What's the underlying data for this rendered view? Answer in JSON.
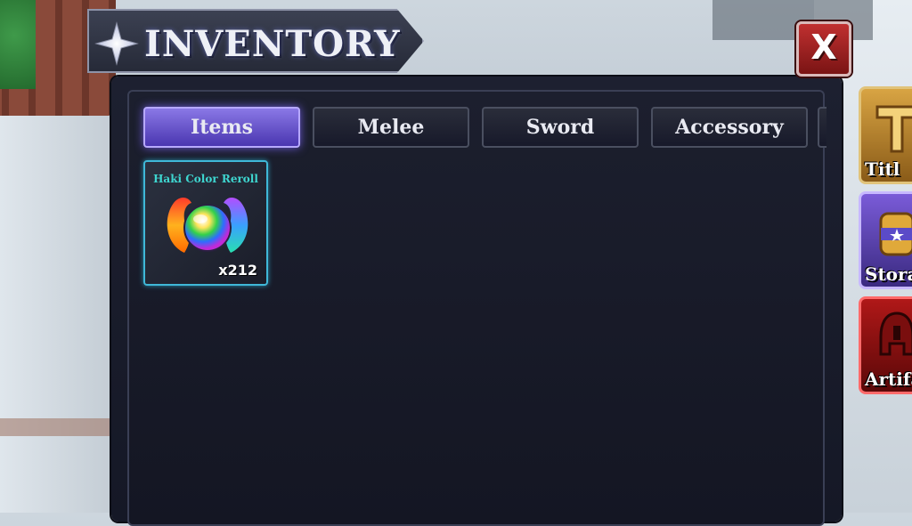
{
  "header": {
    "title": "INVENTORY"
  },
  "close_button": {
    "label": "X"
  },
  "tabs": [
    {
      "label": "Items",
      "active": true
    },
    {
      "label": "Melee",
      "active": false
    },
    {
      "label": "Sword",
      "active": false
    },
    {
      "label": "Accessory",
      "active": false
    }
  ],
  "items": [
    {
      "name": "Haki Color Reroll",
      "quantity": "x212"
    }
  ],
  "side_menu": [
    {
      "label": "Titl",
      "icon": "title-icon",
      "border": "#e1c37a"
    },
    {
      "label": "Stora",
      "icon": "storage-icon",
      "border": "#c7b8ff"
    },
    {
      "label": "Artifa",
      "icon": "artifact-icon",
      "border": "#ff6a6a"
    }
  ],
  "colors": {
    "accent_active_tab": "#6c5ad8",
    "item_border": "#3fb8d8",
    "close_red": "#c03030"
  }
}
